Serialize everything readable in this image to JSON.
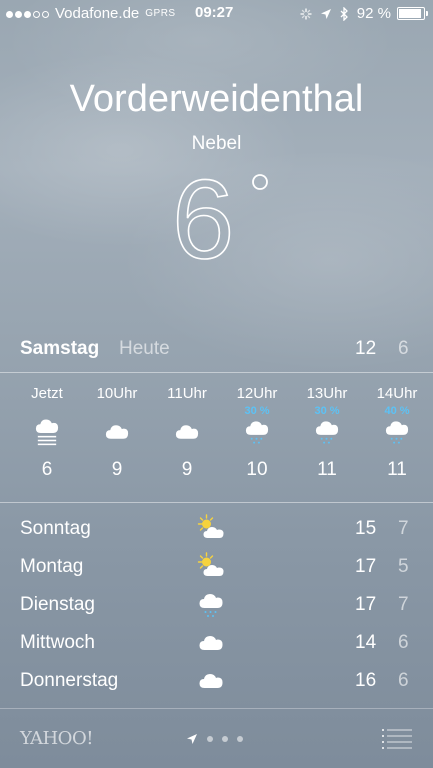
{
  "status_bar": {
    "carrier": "Vodafone.de",
    "network": "GPRS",
    "time": "09:27",
    "battery": "92 %",
    "battery_level": 0.92
  },
  "location": {
    "city": "Vorderweidenthal",
    "condition": "Nebel",
    "temperature": "6"
  },
  "today": {
    "day": "Samstag",
    "label": "Heute",
    "high": "12",
    "low": "6"
  },
  "hourly": [
    {
      "time": "Jetzt",
      "precip": "",
      "icon": "fog-icon",
      "temp": "6"
    },
    {
      "time": "10Uhr",
      "precip": "",
      "icon": "cloud-icon",
      "temp": "9"
    },
    {
      "time": "11Uhr",
      "precip": "",
      "icon": "cloud-icon",
      "temp": "9"
    },
    {
      "time": "12Uhr",
      "precip": "30 %",
      "icon": "rain-cloud-icon",
      "temp": "10"
    },
    {
      "time": "13Uhr",
      "precip": "30 %",
      "icon": "rain-cloud-icon",
      "temp": "11"
    },
    {
      "time": "14Uhr",
      "precip": "40 %",
      "icon": "rain-cloud-icon",
      "temp": "11"
    }
  ],
  "daily": [
    {
      "day": "Sonntag",
      "icon": "partly-sunny-icon",
      "high": "15",
      "low": "7"
    },
    {
      "day": "Montag",
      "icon": "partly-sunny-icon",
      "high": "17",
      "low": "5"
    },
    {
      "day": "Dienstag",
      "icon": "rain-cloud-icon",
      "high": "17",
      "low": "7"
    },
    {
      "day": "Mittwoch",
      "icon": "cloud-icon",
      "high": "14",
      "low": "6"
    },
    {
      "day": "Donnerstag",
      "icon": "cloud-icon",
      "high": "16",
      "low": "6"
    }
  ],
  "footer": {
    "brand": "YAHOO!",
    "pages": 3
  },
  "colors": {
    "precip": "#5cc2f5",
    "sun": "#f7d33d"
  }
}
